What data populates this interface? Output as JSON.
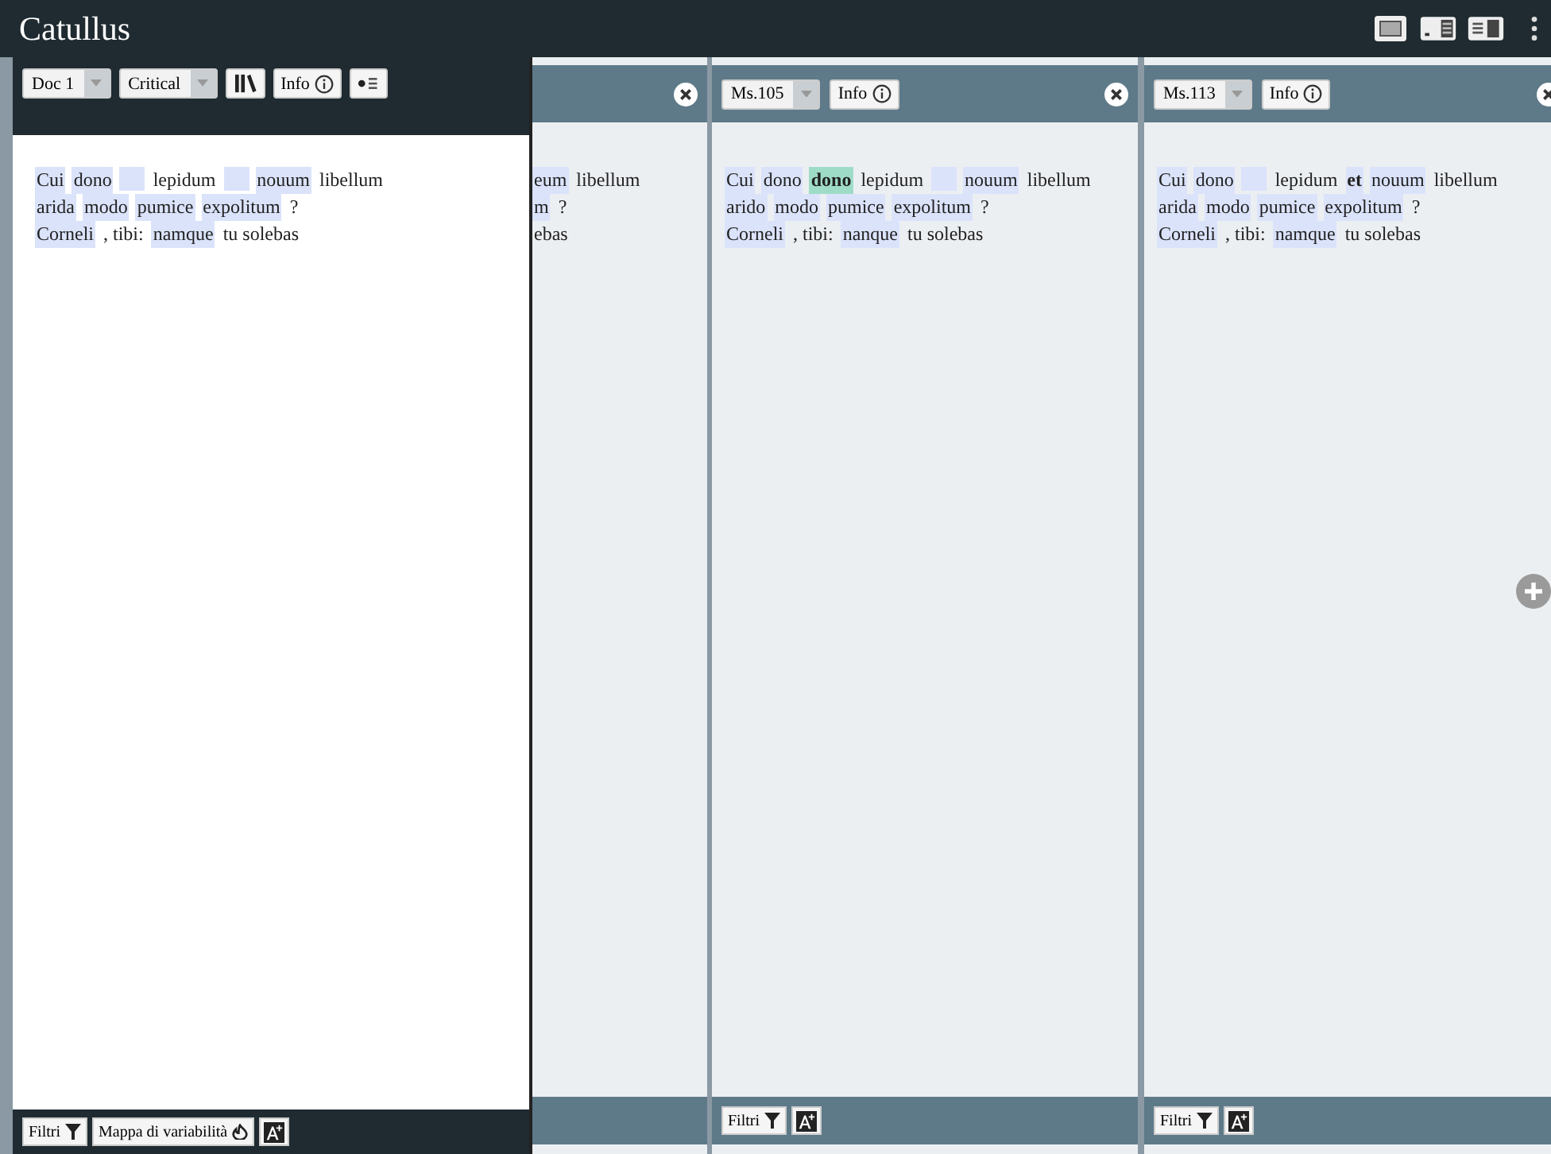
{
  "app": {
    "title": "Catullus"
  },
  "main_panel": {
    "doc_select": "Doc 1",
    "edition_select": "Critical",
    "info_button": "Info",
    "lines": [
      [
        {
          "text": "Cui",
          "kind": "mark"
        },
        {
          "text": "dono",
          "kind": "mark"
        },
        {
          "kind": "gap"
        },
        {
          "text": "lepidum",
          "kind": "plain"
        },
        {
          "kind": "gap"
        },
        {
          "text": "nouum",
          "kind": "mark"
        },
        {
          "text": "libellum",
          "kind": "plain"
        }
      ],
      [
        {
          "text": "arida",
          "kind": "mark"
        },
        {
          "text": "modo",
          "kind": "mark"
        },
        {
          "text": "pumice",
          "kind": "mark"
        },
        {
          "text": "expolitum",
          "kind": "mark"
        },
        {
          "text": "?",
          "kind": "plain"
        }
      ],
      [
        {
          "text": "Corneli",
          "kind": "mark"
        },
        {
          "text": ", tibi:",
          "kind": "plain"
        },
        {
          "text": "namque",
          "kind": "mark"
        },
        {
          "text": "tu solebas",
          "kind": "plain"
        }
      ]
    ],
    "footer": {
      "filter_button": "Filtri",
      "variability_button": "Mappa di variabilità"
    }
  },
  "hidden_panel": {
    "lines": [
      [
        {
          "text": "eum",
          "kind": "mark"
        },
        {
          "text": "libellum",
          "kind": "plain"
        }
      ],
      [
        {
          "text": "m",
          "kind": "mark"
        },
        {
          "text": "?",
          "kind": "plain"
        }
      ],
      [
        {
          "text": "ebas",
          "kind": "plain"
        }
      ]
    ]
  },
  "witness_panels": [
    {
      "select": "Ms.105",
      "info_button": "Info",
      "filter_button": "Filtri",
      "lines": [
        [
          {
            "text": "Cui",
            "kind": "mark"
          },
          {
            "text": "dono",
            "kind": "mark"
          },
          {
            "text": "dono",
            "kind": "diff"
          },
          {
            "text": "lepidum",
            "kind": "plain"
          },
          {
            "kind": "gap"
          },
          {
            "text": "nouum",
            "kind": "mark"
          },
          {
            "text": "libellum",
            "kind": "plain"
          }
        ],
        [
          {
            "text": "arido",
            "kind": "mark"
          },
          {
            "text": "modo",
            "kind": "mark"
          },
          {
            "text": "pumice",
            "kind": "mark"
          },
          {
            "text": "expolitum",
            "kind": "mark"
          },
          {
            "text": "?",
            "kind": "plain"
          }
        ],
        [
          {
            "text": "Corneli",
            "kind": "mark"
          },
          {
            "text": ", tibi:",
            "kind": "plain"
          },
          {
            "text": "nanque",
            "kind": "mark"
          },
          {
            "text": "tu solebas",
            "kind": "plain"
          }
        ]
      ]
    },
    {
      "select": "Ms.113",
      "info_button": "Info",
      "filter_button": "Filtri",
      "lines": [
        [
          {
            "text": "Cui",
            "kind": "mark"
          },
          {
            "text": "dono",
            "kind": "mark"
          },
          {
            "kind": "gap"
          },
          {
            "text": "lepidum",
            "kind": "plain"
          },
          {
            "text": "et",
            "kind": "strong"
          },
          {
            "text": "nouum",
            "kind": "mark"
          },
          {
            "text": "libellum",
            "kind": "plain"
          }
        ],
        [
          {
            "text": "arida",
            "kind": "mark"
          },
          {
            "text": "modo",
            "kind": "mark"
          },
          {
            "text": "pumice",
            "kind": "mark"
          },
          {
            "text": "expolitum",
            "kind": "mark"
          },
          {
            "text": "?",
            "kind": "plain"
          }
        ],
        [
          {
            "text": "Corneli",
            "kind": "mark"
          },
          {
            "text": ", tibi:",
            "kind": "plain"
          },
          {
            "text": "namque",
            "kind": "mark"
          },
          {
            "text": "tu solebas",
            "kind": "plain"
          }
        ]
      ]
    }
  ]
}
